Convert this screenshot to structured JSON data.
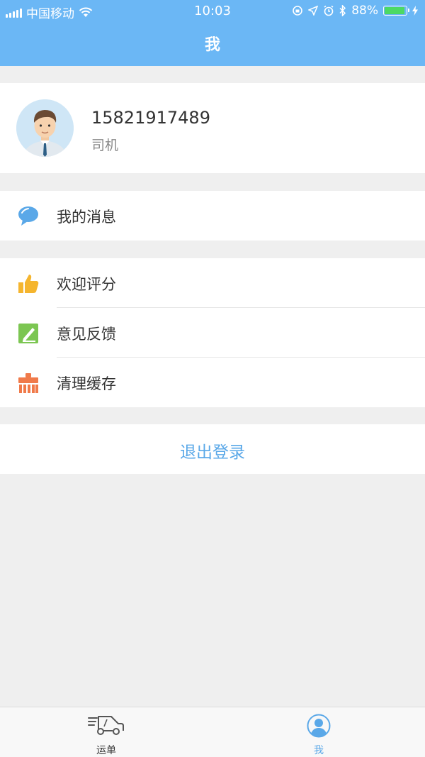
{
  "status_bar": {
    "carrier": "中国移动",
    "time": "10:03",
    "battery": "88%",
    "battery_level": 0.88
  },
  "header": {
    "title": "我"
  },
  "profile": {
    "phone": "15821917489",
    "role": "司机"
  },
  "menu": {
    "messages": {
      "label": "我的消息",
      "icon": "chat-bubble-icon"
    },
    "rate": {
      "label": "欢迎评分",
      "icon": "thumbs-up-icon"
    },
    "feedback": {
      "label": "意见反馈",
      "icon": "edit-icon"
    },
    "cache": {
      "label": "清理缓存",
      "icon": "broom-icon"
    }
  },
  "logout": {
    "label": "退出登录"
  },
  "tabs": [
    {
      "label": "运单",
      "icon": "truck-icon"
    },
    {
      "label": "我",
      "icon": "person-icon"
    }
  ],
  "colors": {
    "header": "#6bb7f5",
    "accent": "#5aa8e8",
    "background": "#efefef"
  }
}
